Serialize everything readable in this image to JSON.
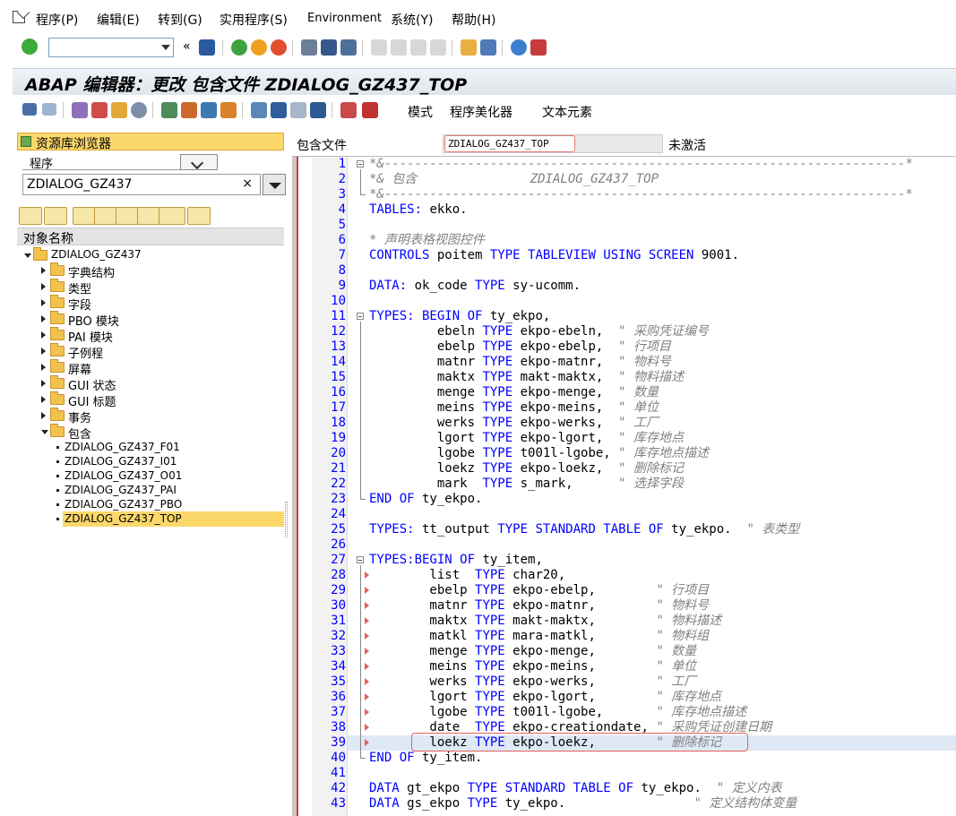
{
  "menubar": {
    "items": [
      "程序(P)",
      "编辑(E)",
      "转到(G)",
      "实用程序(S)",
      "Environment",
      "系统(Y)",
      "帮助(H)"
    ]
  },
  "title": "ABAP 编辑器：更改 包含文件 ZDIALOG_GZ437_TOP",
  "toolbar2": {
    "mode_label": "模式",
    "pretty_printer_label": "程序美化器",
    "text_elements_label": "文本元素"
  },
  "left": {
    "header": "资源库浏览器",
    "object_type": "程序",
    "object_name": "ZDIALOG_GZ437",
    "clear_symbol": "×",
    "column_header": "对象名称",
    "tree": {
      "root": "ZDIALOG_GZ437",
      "folders": [
        "字典结构",
        "类型",
        "字段",
        "PBO 模块",
        "PAI 模块",
        "子例程",
        "屏幕",
        "GUI 状态",
        "GUI 标题",
        "事务"
      ],
      "open_folder": "包含",
      "includes": [
        "ZDIALOG_GZ437_F01",
        "ZDIALOG_GZ437_I01",
        "ZDIALOG_GZ437_O01",
        "ZDIALOG_GZ437_PAI",
        "ZDIALOG_GZ437_PBO",
        "ZDIALOG_GZ437_TOP"
      ]
    }
  },
  "right": {
    "include_label": "包含文件",
    "include_value": "ZDIALOG_GZ437_TOP",
    "status": "未激活"
  },
  "code_lines": [
    [
      [
        "cm",
        "*&---------------------------------------------------------------------*"
      ]
    ],
    [
      [
        "cm",
        "*& 包含               ZDIALOG_GZ437_TOP"
      ]
    ],
    [
      [
        "cm",
        "*&---------------------------------------------------------------------*"
      ]
    ],
    [
      [
        "kw",
        "TABLES:"
      ],
      [
        "tx",
        " ekko."
      ]
    ],
    [],
    [
      [
        "cm",
        "* 声明表格视图控件"
      ]
    ],
    [
      [
        "kw",
        "CONTROLS"
      ],
      [
        "tx",
        " poitem "
      ],
      [
        "kw",
        "TYPE TABLEVIEW USING SCREEN"
      ],
      [
        "tx",
        " 9001."
      ]
    ],
    [],
    [
      [
        "kw",
        "DATA:"
      ],
      [
        "tx",
        " ok_code "
      ],
      [
        "kw",
        "TYPE"
      ],
      [
        "tx",
        " sy-ucomm."
      ]
    ],
    [],
    [
      [
        "kw",
        "TYPES: BEGIN OF"
      ],
      [
        "tx",
        " ty_ekpo,"
      ]
    ],
    [
      [
        "tx",
        "         ebeln "
      ],
      [
        "kw",
        "TYPE"
      ],
      [
        "tx",
        " ekpo-ebeln,  "
      ],
      [
        "cm",
        "\" 采购凭证编号"
      ]
    ],
    [
      [
        "tx",
        "         ebelp "
      ],
      [
        "kw",
        "TYPE"
      ],
      [
        "tx",
        " ekpo-ebelp,  "
      ],
      [
        "cm",
        "\" 行项目"
      ]
    ],
    [
      [
        "tx",
        "         matnr "
      ],
      [
        "kw",
        "TYPE"
      ],
      [
        "tx",
        " ekpo-matnr,  "
      ],
      [
        "cm",
        "\" 物料号"
      ]
    ],
    [
      [
        "tx",
        "         maktx "
      ],
      [
        "kw",
        "TYPE"
      ],
      [
        "tx",
        " makt-maktx,  "
      ],
      [
        "cm",
        "\" 物料描述"
      ]
    ],
    [
      [
        "tx",
        "         menge "
      ],
      [
        "kw",
        "TYPE"
      ],
      [
        "tx",
        " ekpo-menge,  "
      ],
      [
        "cm",
        "\" 数量"
      ]
    ],
    [
      [
        "tx",
        "         meins "
      ],
      [
        "kw",
        "TYPE"
      ],
      [
        "tx",
        " ekpo-meins,  "
      ],
      [
        "cm",
        "\" 单位"
      ]
    ],
    [
      [
        "tx",
        "         werks "
      ],
      [
        "kw",
        "TYPE"
      ],
      [
        "tx",
        " ekpo-werks,  "
      ],
      [
        "cm",
        "\" 工厂"
      ]
    ],
    [
      [
        "tx",
        "         lgort "
      ],
      [
        "kw",
        "TYPE"
      ],
      [
        "tx",
        " ekpo-lgort,  "
      ],
      [
        "cm",
        "\" 库存地点"
      ]
    ],
    [
      [
        "tx",
        "         lgobe "
      ],
      [
        "kw",
        "TYPE"
      ],
      [
        "tx",
        " t001l-lgobe, "
      ],
      [
        "cm",
        "\" 库存地点描述"
      ]
    ],
    [
      [
        "tx",
        "         loekz "
      ],
      [
        "kw",
        "TYPE"
      ],
      [
        "tx",
        " ekpo-loekz,  "
      ],
      [
        "cm",
        "\" 删除标记"
      ]
    ],
    [
      [
        "tx",
        "         mark  "
      ],
      [
        "kw",
        "TYPE"
      ],
      [
        "tx",
        " s_mark,      "
      ],
      [
        "cm",
        "\" 选择字段"
      ]
    ],
    [
      [
        "kw",
        "END OF"
      ],
      [
        "tx",
        " ty_ekpo."
      ]
    ],
    [],
    [
      [
        "kw",
        "TYPES:"
      ],
      [
        "tx",
        " tt_output "
      ],
      [
        "kw",
        "TYPE STANDARD TABLE OF"
      ],
      [
        "tx",
        " ty_ekpo.  "
      ],
      [
        "cm",
        "\" 表类型"
      ]
    ],
    [],
    [
      [
        "kw",
        "TYPES:BEGIN OF"
      ],
      [
        "tx",
        " ty_item,"
      ]
    ],
    [
      [
        "tx",
        "        list  "
      ],
      [
        "kw",
        "TYPE"
      ],
      [
        "tx",
        " char20,"
      ]
    ],
    [
      [
        "tx",
        "        ebelp "
      ],
      [
        "kw",
        "TYPE"
      ],
      [
        "tx",
        " ekpo-ebelp,        "
      ],
      [
        "cm",
        "\" 行项目"
      ]
    ],
    [
      [
        "tx",
        "        matnr "
      ],
      [
        "kw",
        "TYPE"
      ],
      [
        "tx",
        " ekpo-matnr,        "
      ],
      [
        "cm",
        "\" 物料号"
      ]
    ],
    [
      [
        "tx",
        "        maktx "
      ],
      [
        "kw",
        "TYPE"
      ],
      [
        "tx",
        " makt-maktx,        "
      ],
      [
        "cm",
        "\" 物料描述"
      ]
    ],
    [
      [
        "tx",
        "        matkl "
      ],
      [
        "kw",
        "TYPE"
      ],
      [
        "tx",
        " mara-matkl,        "
      ],
      [
        "cm",
        "\" 物料组"
      ]
    ],
    [
      [
        "tx",
        "        menge "
      ],
      [
        "kw",
        "TYPE"
      ],
      [
        "tx",
        " ekpo-menge,        "
      ],
      [
        "cm",
        "\" 数量"
      ]
    ],
    [
      [
        "tx",
        "        meins "
      ],
      [
        "kw",
        "TYPE"
      ],
      [
        "tx",
        " ekpo-meins,        "
      ],
      [
        "cm",
        "\" 单位"
      ]
    ],
    [
      [
        "tx",
        "        werks "
      ],
      [
        "kw",
        "TYPE"
      ],
      [
        "tx",
        " ekpo-werks,        "
      ],
      [
        "cm",
        "\" 工厂"
      ]
    ],
    [
      [
        "tx",
        "        lgort "
      ],
      [
        "kw",
        "TYPE"
      ],
      [
        "tx",
        " ekpo-lgort,        "
      ],
      [
        "cm",
        "\" 库存地点"
      ]
    ],
    [
      [
        "tx",
        "        lgobe "
      ],
      [
        "kw",
        "TYPE"
      ],
      [
        "tx",
        " t001l-lgobe,       "
      ],
      [
        "cm",
        "\" 库存地点描述"
      ]
    ],
    [
      [
        "tx",
        "        date  "
      ],
      [
        "kw",
        "TYPE"
      ],
      [
        "tx",
        " ekpo-creationdate, "
      ],
      [
        "cm",
        "\" 采购凭证创建日期"
      ]
    ],
    [
      [
        "tx",
        "        loekz "
      ],
      [
        "kw",
        "TYPE"
      ],
      [
        "tx",
        " ekpo-loekz,        "
      ],
      [
        "cm",
        "\" 删除标记"
      ]
    ],
    [
      [
        "kw",
        "END OF"
      ],
      [
        "tx",
        " ty_item."
      ]
    ],
    [],
    [
      [
        "kw",
        "DATA"
      ],
      [
        "tx",
        " gt_ekpo "
      ],
      [
        "kw",
        "TYPE STANDARD TABLE OF"
      ],
      [
        "tx",
        " ty_ekpo.  "
      ],
      [
        "cm",
        "\" 定义内表"
      ]
    ],
    [
      [
        "kw",
        "DATA"
      ],
      [
        "tx",
        " gs_ekpo "
      ],
      [
        "kw",
        "TYPE"
      ],
      [
        "tx",
        " ty_ekpo.                 "
      ],
      [
        "cm",
        "\" 定义结构体变量"
      ]
    ]
  ]
}
